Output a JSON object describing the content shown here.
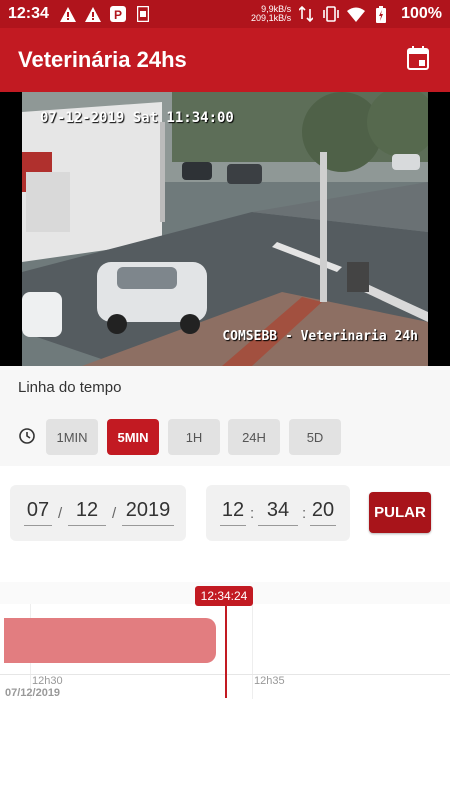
{
  "status_bar": {
    "time": "12:34",
    "net_up": "9,9kB/s",
    "net_down": "209,1kB/s",
    "battery": "100%"
  },
  "app_bar": {
    "title": "Veterinária 24hs",
    "calendar_icon": "calendar-icon"
  },
  "video": {
    "osd_timestamp": "07-12-2019 Sat 11:34:00",
    "osd_camera": "COMSEBB - Veterinaria 24h"
  },
  "timeline_section": {
    "label": "Linha do tempo",
    "ranges": [
      "1MIN",
      "5MIN",
      "1H",
      "24H",
      "5D"
    ],
    "selected_range": "5MIN"
  },
  "date_time": {
    "day": "07",
    "month": "12",
    "year": "2019",
    "hour": "12",
    "minute": "34",
    "second": "20",
    "jump_label": "PULAR"
  },
  "timeline_chart": {
    "cursor_time": "12:34:24",
    "ticks": [
      "12h30",
      "12h35"
    ],
    "date": "07/12/2019"
  },
  "colors": {
    "primary": "#c21a22",
    "status_bar": "#b0141c",
    "recording_bar": "#e27d80"
  }
}
